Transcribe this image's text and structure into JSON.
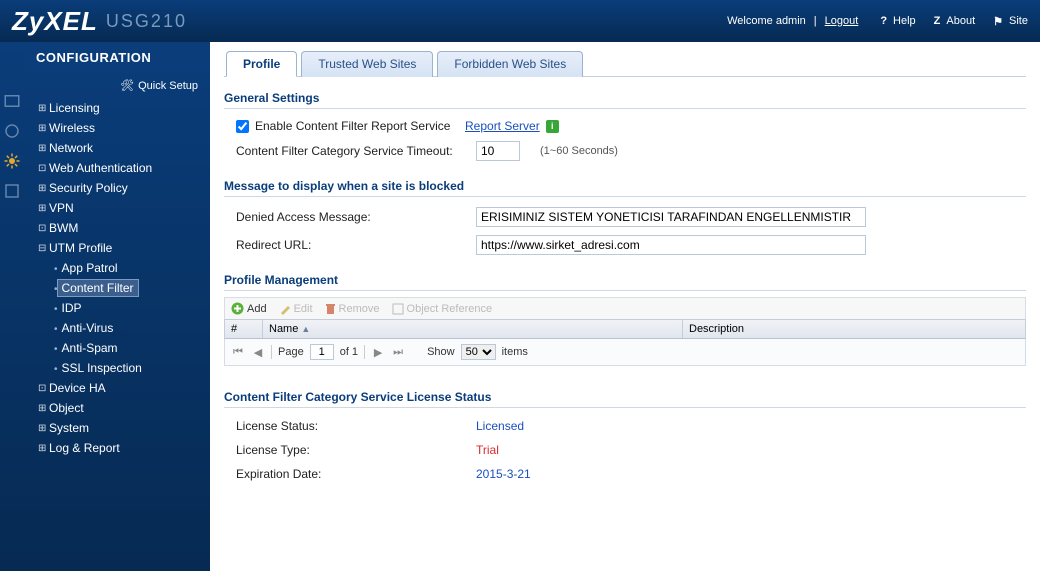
{
  "header": {
    "brand": "ZyXEL",
    "model": "USG210",
    "welcome": "Welcome admin",
    "logout": "Logout",
    "help": "Help",
    "about": "About",
    "site": "Site"
  },
  "sidebar": {
    "title": "CONFIGURATION",
    "quick_setup": "Quick Setup",
    "items": [
      {
        "label": "Licensing",
        "expand": "plus",
        "type": "folder"
      },
      {
        "label": "Wireless",
        "expand": "plus",
        "type": "folder"
      },
      {
        "label": "Network",
        "expand": "plus",
        "type": "folder"
      },
      {
        "label": "Web Authentication",
        "expand": "dot",
        "type": "folder"
      },
      {
        "label": "Security Policy",
        "expand": "plus",
        "type": "folder"
      },
      {
        "label": "VPN",
        "expand": "plus",
        "type": "folder"
      },
      {
        "label": "BWM",
        "expand": "dot",
        "type": "folder"
      },
      {
        "label": "UTM Profile",
        "expand": "minus",
        "type": "folder"
      },
      {
        "label": "App Patrol",
        "type": "sub"
      },
      {
        "label": "Content Filter",
        "type": "sub",
        "selected": true
      },
      {
        "label": "IDP",
        "type": "sub"
      },
      {
        "label": "Anti-Virus",
        "type": "sub"
      },
      {
        "label": "Anti-Spam",
        "type": "sub"
      },
      {
        "label": "SSL Inspection",
        "type": "sub"
      },
      {
        "label": "Device HA",
        "expand": "dot",
        "type": "folder"
      },
      {
        "label": "Object",
        "expand": "plus",
        "type": "folder"
      },
      {
        "label": "System",
        "expand": "plus",
        "type": "folder"
      },
      {
        "label": "Log & Report",
        "expand": "plus",
        "type": "folder"
      }
    ]
  },
  "tabs": {
    "profile": "Profile",
    "trusted": "Trusted Web Sites",
    "forbidden": "Forbidden Web Sites"
  },
  "general": {
    "title": "General Settings",
    "enable_label": "Enable Content Filter Report Service",
    "report_server": "Report Server",
    "timeout_label": "Content Filter Category Service Timeout:",
    "timeout_value": "10",
    "timeout_hint": "(1~60 Seconds)"
  },
  "blocked": {
    "title": "Message to display when a site is blocked",
    "denied_label": "Denied Access Message:",
    "denied_value": "ERISIMINIZ SISTEM YONETICISI TARAFINDAN ENGELLENMISTIR",
    "redirect_label": "Redirect URL:",
    "redirect_value": "https://www.sirket_adresi.com"
  },
  "profile_mgmt": {
    "title": "Profile Management",
    "add": "Add",
    "edit": "Edit",
    "remove": "Remove",
    "objref": "Object Reference",
    "col_num": "#",
    "col_name": "Name",
    "col_desc": "Description",
    "page_label": "Page",
    "page_value": "1",
    "of_label": "of 1",
    "show_label": "Show",
    "show_value": "50",
    "items_label": "items"
  },
  "license": {
    "title": "Content Filter Category Service License Status",
    "status_label": "License Status:",
    "status_value": "Licensed",
    "type_label": "License Type:",
    "type_value": "Trial",
    "exp_label": "Expiration Date:",
    "exp_value": "2015-3-21"
  }
}
